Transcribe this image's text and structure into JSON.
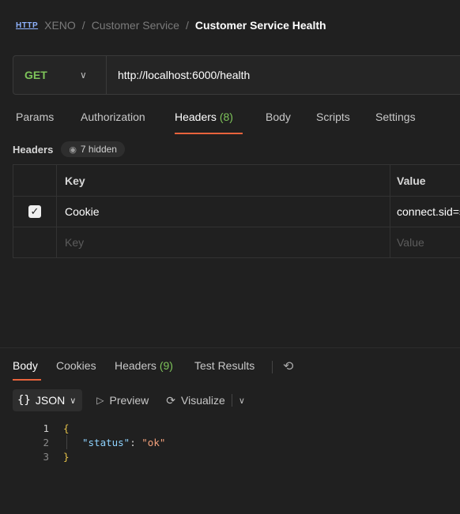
{
  "breadcrumb": {
    "icon": "HTTP",
    "workspace": "XENO",
    "sep1": "/",
    "collection": "Customer Service",
    "sep2": "/",
    "request": "Customer Service Health"
  },
  "request": {
    "method": "GET",
    "url": "http://localhost:6000/health"
  },
  "request_tabs": {
    "params": "Params",
    "authorization": "Authorization",
    "headers": "Headers",
    "headers_count": "(8)",
    "body": "Body",
    "scripts": "Scripts",
    "settings": "Settings"
  },
  "headers_section": {
    "label": "Headers",
    "hidden": "7 hidden"
  },
  "headers_table": {
    "col_key": "Key",
    "col_value": "Value",
    "rows": [
      {
        "checked": true,
        "key": "Cookie",
        "value": "connect.sid=s"
      }
    ],
    "placeholder_key": "Key",
    "placeholder_value": "Value"
  },
  "response_tabs": {
    "body": "Body",
    "cookies": "Cookies",
    "headers": "Headers",
    "headers_count": "(9)",
    "test_results": "Test Results"
  },
  "format_toolbar": {
    "format": "JSON",
    "preview": "Preview",
    "visualize": "Visualize"
  },
  "response_body": {
    "line_numbers": [
      "1",
      "2",
      "3"
    ],
    "open_brace": "{",
    "key": "\"status\"",
    "colon": ": ",
    "value": "\"ok\"",
    "close_brace": "}"
  },
  "colors": {
    "accent": "#e8633c",
    "method": "#7ec45a",
    "background": "#202020"
  }
}
